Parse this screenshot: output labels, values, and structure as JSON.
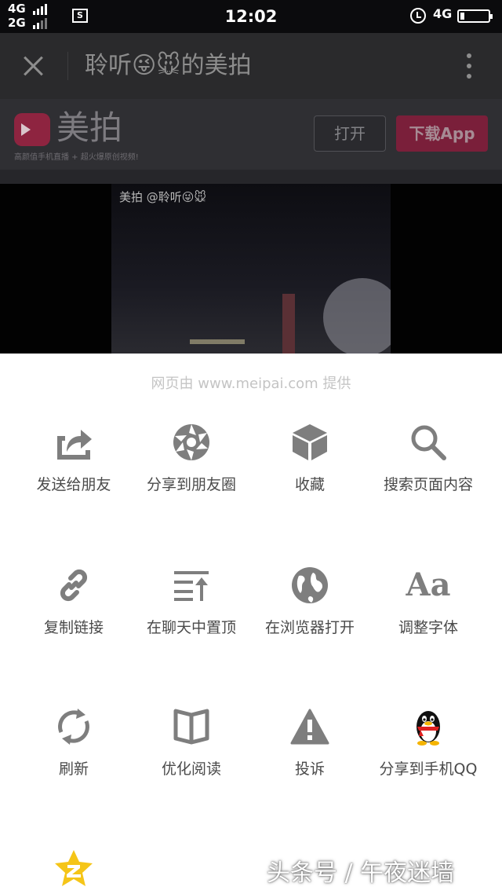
{
  "status_bar": {
    "sim1_network": "4G",
    "sim2_network": "2G",
    "time": "12:02",
    "right_network": "4G",
    "battery_level": 0.15
  },
  "title_bar": {
    "title": "聆听😜🐭的美拍"
  },
  "banner": {
    "logo_text": "美拍",
    "slogan": "高颜值手机直播 + 超火爆原创视频!",
    "open_button": "打开",
    "download_button": "下载App"
  },
  "video": {
    "watermark": "美拍 @聆听😜🐭"
  },
  "sheet": {
    "provider": "网页由 www.meipai.com 提供",
    "items": [
      {
        "label": "发送给朋友",
        "icon": "share-arrow-icon"
      },
      {
        "label": "分享到朋友圈",
        "icon": "moments-aperture-icon"
      },
      {
        "label": "收藏",
        "icon": "favorite-cube-icon"
      },
      {
        "label": "搜索页面内容",
        "icon": "search-icon"
      },
      {
        "label": "复制链接",
        "icon": "link-icon"
      },
      {
        "label": "在聊天中置顶",
        "icon": "pin-top-icon"
      },
      {
        "label": "在浏览器打开",
        "icon": "globe-icon"
      },
      {
        "label": "调整字体",
        "icon": "font-size-icon",
        "glyph": "Aa"
      },
      {
        "label": "刷新",
        "icon": "refresh-icon"
      },
      {
        "label": "优化阅读",
        "icon": "book-icon"
      },
      {
        "label": "投诉",
        "icon": "warning-icon"
      },
      {
        "label": "分享到手机QQ",
        "icon": "qq-penguin-icon"
      },
      {
        "label": "",
        "icon": "qzone-star-icon"
      }
    ]
  },
  "credit": "头条号 / 午夜迷墙",
  "colors": {
    "sheet_bg": "#ffffff",
    "icon_gray": "#7e7e7e",
    "label_text": "#4a4a4a",
    "download_bg": "#7a1f3a",
    "qzone_yellow": "#f5c518"
  }
}
